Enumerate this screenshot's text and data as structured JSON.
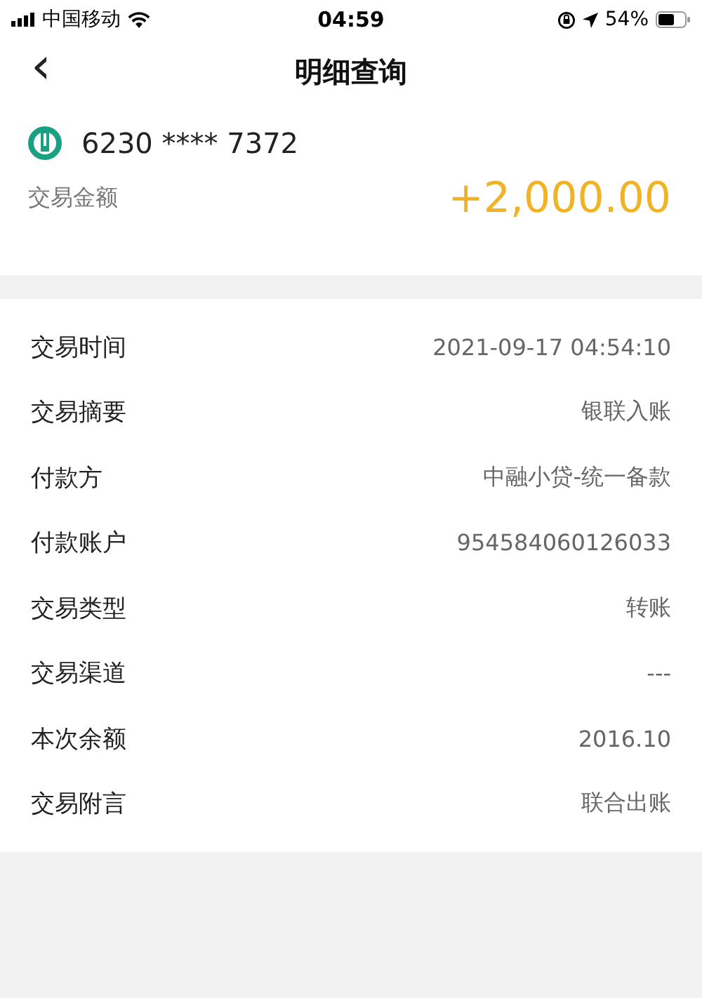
{
  "status_bar": {
    "carrier": "中国移动",
    "time": "04:59",
    "battery": "54%"
  },
  "header": {
    "back": "‹",
    "title": "明细查询"
  },
  "account": {
    "number": "6230 **** 7372",
    "amount_label": "交易金额",
    "amount": "+2,000.00"
  },
  "details": [
    {
      "label": "交易时间",
      "value": "2021-09-17 04:54:10"
    },
    {
      "label": "交易摘要",
      "value": "银联入账"
    },
    {
      "label": "付款方",
      "value": "中融小贷-统一备款"
    },
    {
      "label": "付款账户",
      "value": "954584060126033"
    },
    {
      "label": "交易类型",
      "value": "转账"
    },
    {
      "label": "交易渠道",
      "value": "---"
    },
    {
      "label": "本次余额",
      "value": "2016.10"
    },
    {
      "label": "交易附言",
      "value": "联合出账"
    }
  ]
}
